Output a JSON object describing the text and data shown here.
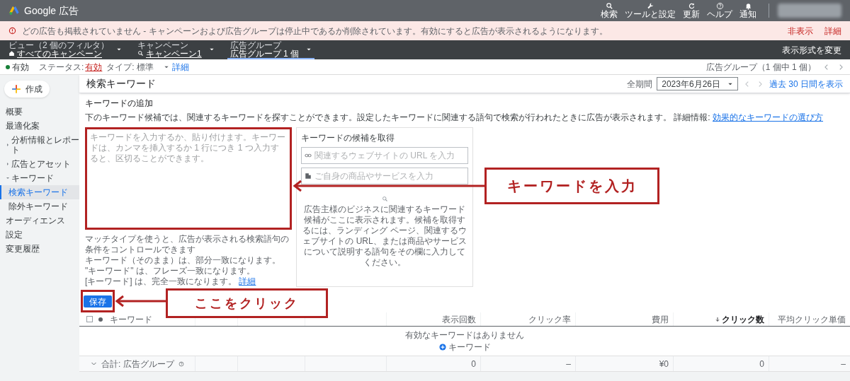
{
  "header": {
    "product": "Google 広告",
    "tools": [
      {
        "kind": "search",
        "label": "検索"
      },
      {
        "kind": "wrench",
        "label": "ツールと設定"
      },
      {
        "kind": "refresh",
        "label": "更新"
      },
      {
        "kind": "help",
        "label": "ヘルプ"
      },
      {
        "kind": "bell",
        "label": "通知"
      }
    ]
  },
  "alert": {
    "message": "どの広告も掲載されていません - キャンペーンおよび広告グループは停止中であるか削除されています。有効にすると広告が表示されるようになります。",
    "actions": [
      "非表示",
      "詳細"
    ]
  },
  "breadcrumbs": [
    {
      "kind": "home",
      "label": "ビュー（2 個のフィルタ）",
      "value": "すべてのキャンペーン",
      "selected": false
    },
    {
      "kind": "search",
      "label": "キャンペーン",
      "value": "キャンペーン1",
      "selected": false
    },
    {
      "kind": "none",
      "label": "広告グループ",
      "value": "広告グループ 1 個",
      "selected": true
    }
  ],
  "view_switch": "表示形式を変更",
  "filters": {
    "chip": "有効",
    "status_label": "ステータス:",
    "status_value": "有効",
    "type": "タイプ: 標準",
    "details": "詳細",
    "pager": "広告グループ（1 個中 1 個）"
  },
  "sidebar": {
    "create": "作成",
    "items": [
      {
        "label": "概要"
      },
      {
        "label": "最適化案"
      },
      {
        "label": "分析情報とレポート",
        "expanded": false
      },
      {
        "label": "広告とアセット",
        "expanded": false
      },
      {
        "label": "キーワード",
        "expanded": true,
        "children": [
          {
            "label": "検索キーワード",
            "selected": true
          },
          {
            "label": "除外キーワード",
            "selected": false
          }
        ]
      },
      {
        "label": "オーディエンス"
      },
      {
        "label": "設定"
      },
      {
        "label": "変更履歴"
      }
    ]
  },
  "page": {
    "title": "検索キーワード",
    "period_label": "全期間",
    "period_value": "2023年6月26日",
    "recent_link": "過去 30 日間を表示"
  },
  "add_keywords": {
    "heading": "キーワードの追加",
    "description": "下のキーワード候補では、関連するキーワードを探すことができます。設定したキーワードに関連する語句で検索が行われたときに広告が表示されます。 詳細情報:",
    "link": "効果的なキーワードの選び方",
    "placeholder": "キーワードを入力するか、貼り付けます。キーワードは、カンマを挿入するか 1 行につき 1 つ入力すると、区切ることができます。",
    "match_help": [
      "マッチタイプを使うと、広告が表示される検索語句の条件をコントロールできます",
      "キーワード（そのまま）は、部分一致になります。",
      "\"キーワード\" は、フレーズ一致になります。",
      "[キーワード] は、完全一致になります。"
    ],
    "match_link": "詳細"
  },
  "suggestions": {
    "title": "キーワードの候補を取得",
    "fields": [
      {
        "kind": "link",
        "placeholder": "関連するウェブサイトの URL を入力"
      },
      {
        "kind": "store",
        "placeholder": "ご自身の商品やサービスを入力"
      }
    ],
    "hint": "広告主様のビジネスに関連するキーワード候補がここに表示されます。候補を取得するには、ランディング ページ、関連するウェブサイトの URL、または商品やサービスについて説明する語句をその欄に入力してください。"
  },
  "save": "保存",
  "table": {
    "select_all_checked": false,
    "keyword_column": "キーワード",
    "columns": [
      {
        "label": "表示回数",
        "sorted": false
      },
      {
        "label": "クリック率",
        "sorted": false
      },
      {
        "label": "費用",
        "sorted": false
      },
      {
        "label": "クリック数",
        "sorted": true
      },
      {
        "label": "平均クリック単価",
        "sorted": false
      }
    ],
    "empty": "有効なキーワードはありません",
    "add": "キーワード",
    "total_label": "合計: 広告グループ",
    "totals": [
      "0",
      "–",
      "¥0",
      "0",
      "–"
    ]
  },
  "annotations": [
    {
      "kind": "input",
      "text": "キーワードを入力"
    },
    {
      "kind": "save",
      "text": "ここをクリック"
    }
  ]
}
